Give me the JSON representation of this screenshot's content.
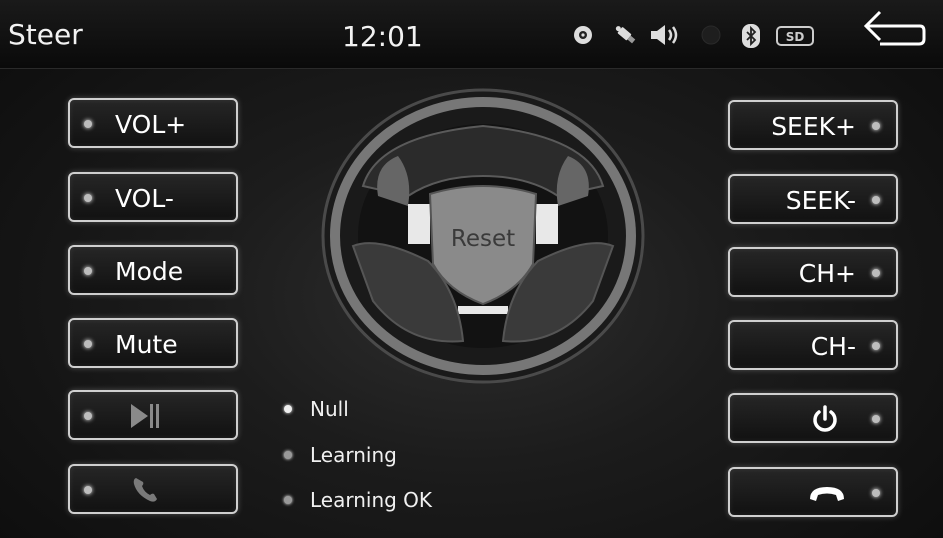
{
  "header": {
    "title": "Steer",
    "time": "12:01",
    "status_icons": [
      "gps-icon",
      "usb-icon",
      "speaker-icon",
      "indicator-off-icon",
      "bluetooth-icon",
      "sd-card-icon"
    ],
    "sd_label": "SD"
  },
  "left_buttons": [
    {
      "label": "VOL+"
    },
    {
      "label": "VOL-"
    },
    {
      "label": "Mode"
    },
    {
      "label": "Mute"
    },
    {
      "icon": "play-pause-icon"
    },
    {
      "icon": "phone-icon"
    }
  ],
  "right_buttons": [
    {
      "label": "SEEK+"
    },
    {
      "label": "SEEK-"
    },
    {
      "label": "CH+"
    },
    {
      "label": "CH-"
    },
    {
      "icon": "power-icon"
    },
    {
      "icon": "hang-up-icon"
    }
  ],
  "wheel": {
    "center_label": "Reset"
  },
  "status_list": [
    {
      "label": "Null"
    },
    {
      "label": "Learning"
    },
    {
      "label": "Learning OK"
    }
  ]
}
